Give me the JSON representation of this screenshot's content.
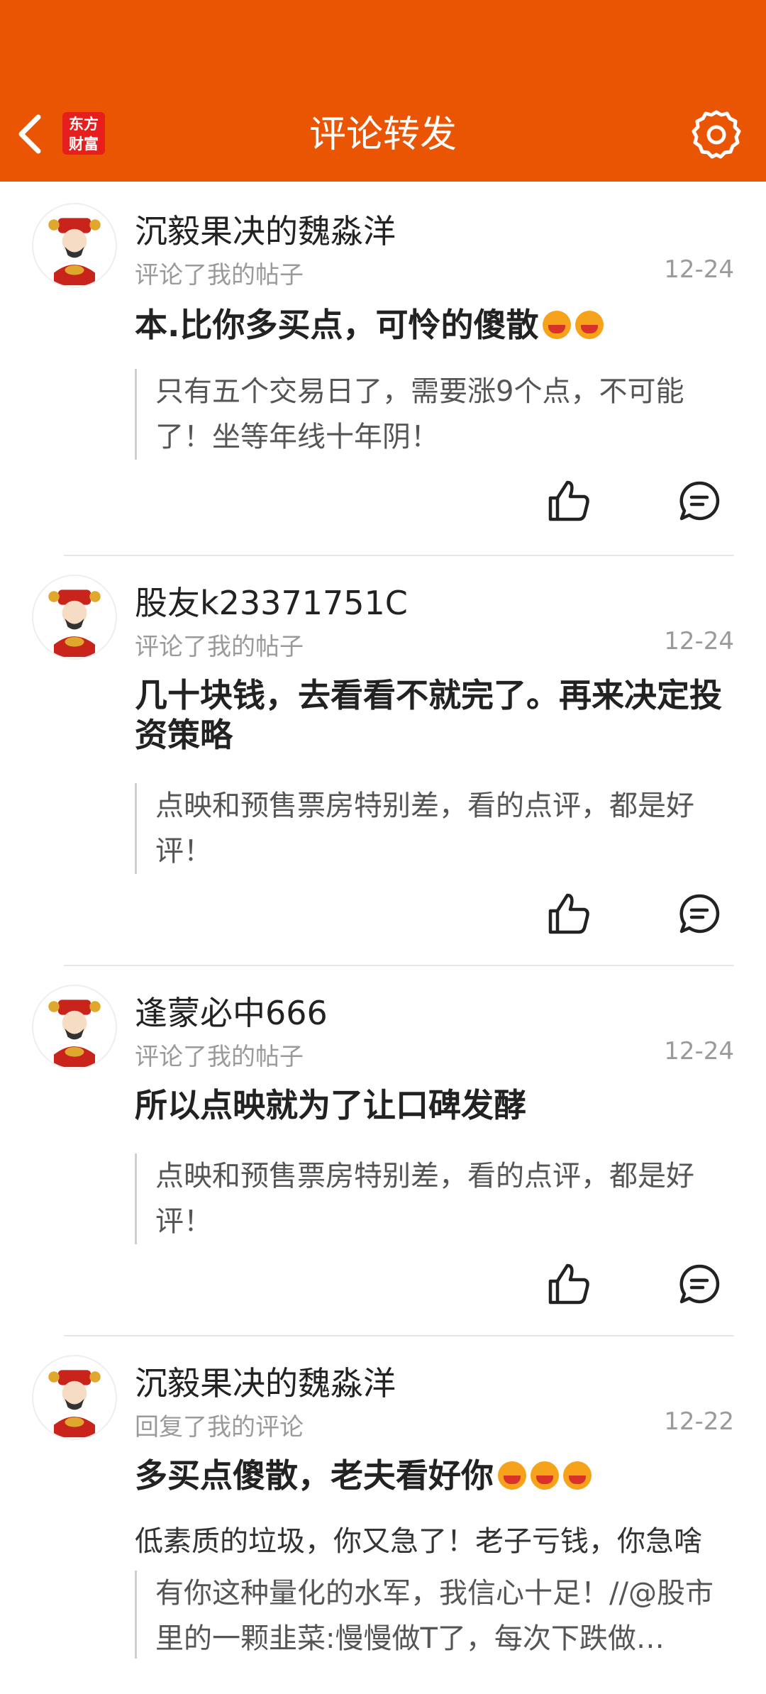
{
  "header": {
    "title": "评论转发",
    "logo_line1": "东方",
    "logo_line2": "财富",
    "icons": {
      "back": "chevron-left-icon",
      "settings": "gear-icon"
    },
    "background": "#ea5504"
  },
  "notifications": [
    {
      "username": "沉毅果决的魏淼洋",
      "action": "评论了我的帖子",
      "date": "12-24",
      "content": "本.比你多买点，可怜的傻散",
      "emoji_count": 2,
      "quote": "只有五个交易日了，需要涨9个点，不可能了！坐等年线十年阴！"
    },
    {
      "username": "股友k23371751C",
      "action": "评论了我的帖子",
      "date": "12-24",
      "content": "几十块钱，去看看不就完了。再来决定投资策略",
      "emoji_count": 0,
      "quote": "点映和预售票房特别差，看的点评，都是好评！"
    },
    {
      "username": "逢蒙必中666",
      "action": "评论了我的帖子",
      "date": "12-24",
      "content": "所以点映就为了让口碑发酵",
      "emoji_count": 0,
      "quote": "点映和预售票房特别差，看的点评，都是好评！"
    },
    {
      "username": "沉毅果决的魏淼洋",
      "action": "回复了我的评论",
      "date": "12-22",
      "content": "多买点傻散，老夫看好你",
      "emoji_count": 3,
      "my_comment": "低素质的垃圾，你又急了！老子亏钱，你急啥",
      "quote": "有你这种量化的水军，我信心十足！//@股市里的一颗韭菜:慢慢做T了，每次下跌做…"
    }
  ]
}
